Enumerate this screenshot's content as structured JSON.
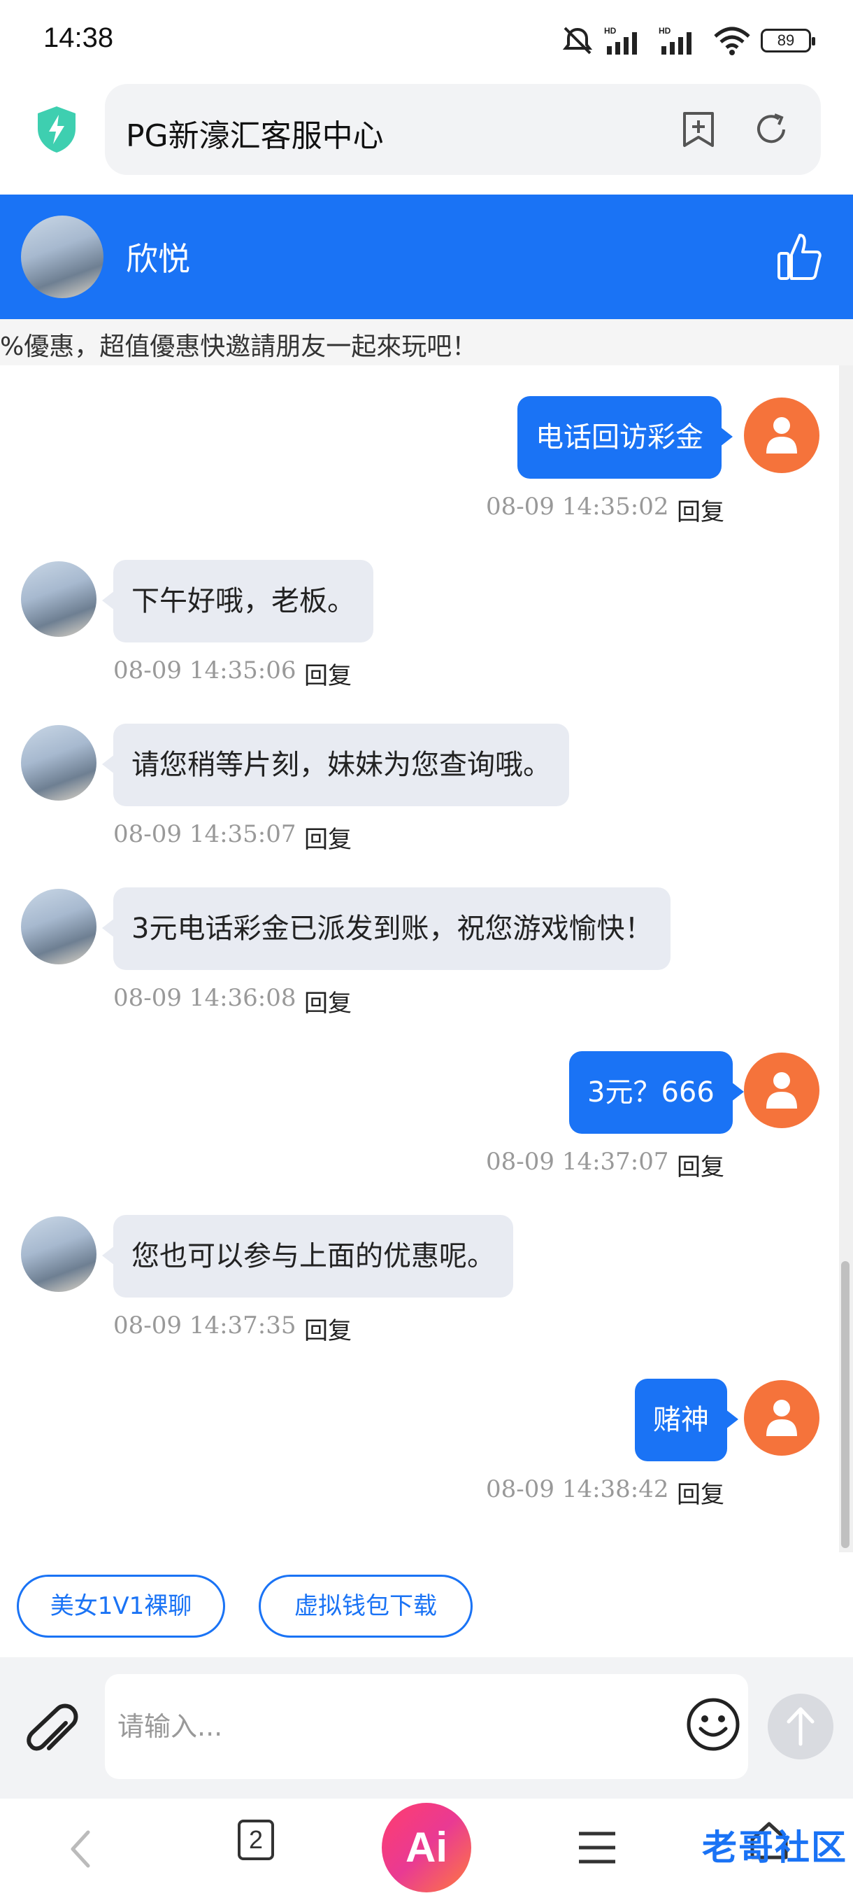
{
  "status_bar": {
    "time": "14:38",
    "battery": "89",
    "icons": [
      "mute-icon",
      "hd-signal-icon",
      "hd-signal-icon",
      "wifi-icon",
      "battery-icon"
    ]
  },
  "browser": {
    "url_title": "PG新濠汇客服中心",
    "icons": [
      "security-shield-icon",
      "bookmark-add-icon",
      "refresh-icon"
    ]
  },
  "chat_header": {
    "agent_name": "欣悦",
    "icons": [
      "agent-avatar",
      "thumbs-up-icon"
    ]
  },
  "marquee": {
    "text": "%優惠，超值優惠快邀請朋友一起來玩吧！"
  },
  "messages": [
    {
      "side": "right",
      "text": "电话回访彩金",
      "time": "08-09 14:35:02",
      "reply": "回复"
    },
    {
      "side": "left",
      "text": "下午好哦，老板。",
      "time": "08-09 14:35:06",
      "reply": "回复"
    },
    {
      "side": "left",
      "text": "请您稍等片刻，妹妹为您查询哦。",
      "time": "08-09 14:35:07",
      "reply": "回复"
    },
    {
      "side": "left",
      "text": "3元电话彩金已派发到账，祝您游戏愉快！",
      "time": "08-09 14:36:08",
      "reply": "回复"
    },
    {
      "side": "right",
      "text": "3元？666",
      "time": "08-09 14:37:07",
      "reply": "回复"
    },
    {
      "side": "left",
      "text": "您也可以参与上面的优惠呢。",
      "time": "08-09 14:37:35",
      "reply": "回复"
    },
    {
      "side": "right",
      "text": "赌神",
      "time": "08-09 14:38:42",
      "reply": "回复"
    }
  ],
  "quick_replies": [
    "美女1V1裸聊",
    "虚拟钱包下载"
  ],
  "input": {
    "placeholder": "请输入...",
    "icons": [
      "paperclip-icon",
      "emoji-icon",
      "send-arrow-icon"
    ]
  },
  "nav_bar": {
    "tab_count": "2",
    "ai_label": "Ai",
    "watermark": "老哥社区",
    "icons": [
      "back-icon",
      "tabs-icon",
      "ai-assistant-icon",
      "menu-icon",
      "home-icon"
    ]
  },
  "colors": {
    "accent": "#1a73f5",
    "user_avatar": "#f5733b",
    "agent_bubble": "#e8ebf2"
  }
}
